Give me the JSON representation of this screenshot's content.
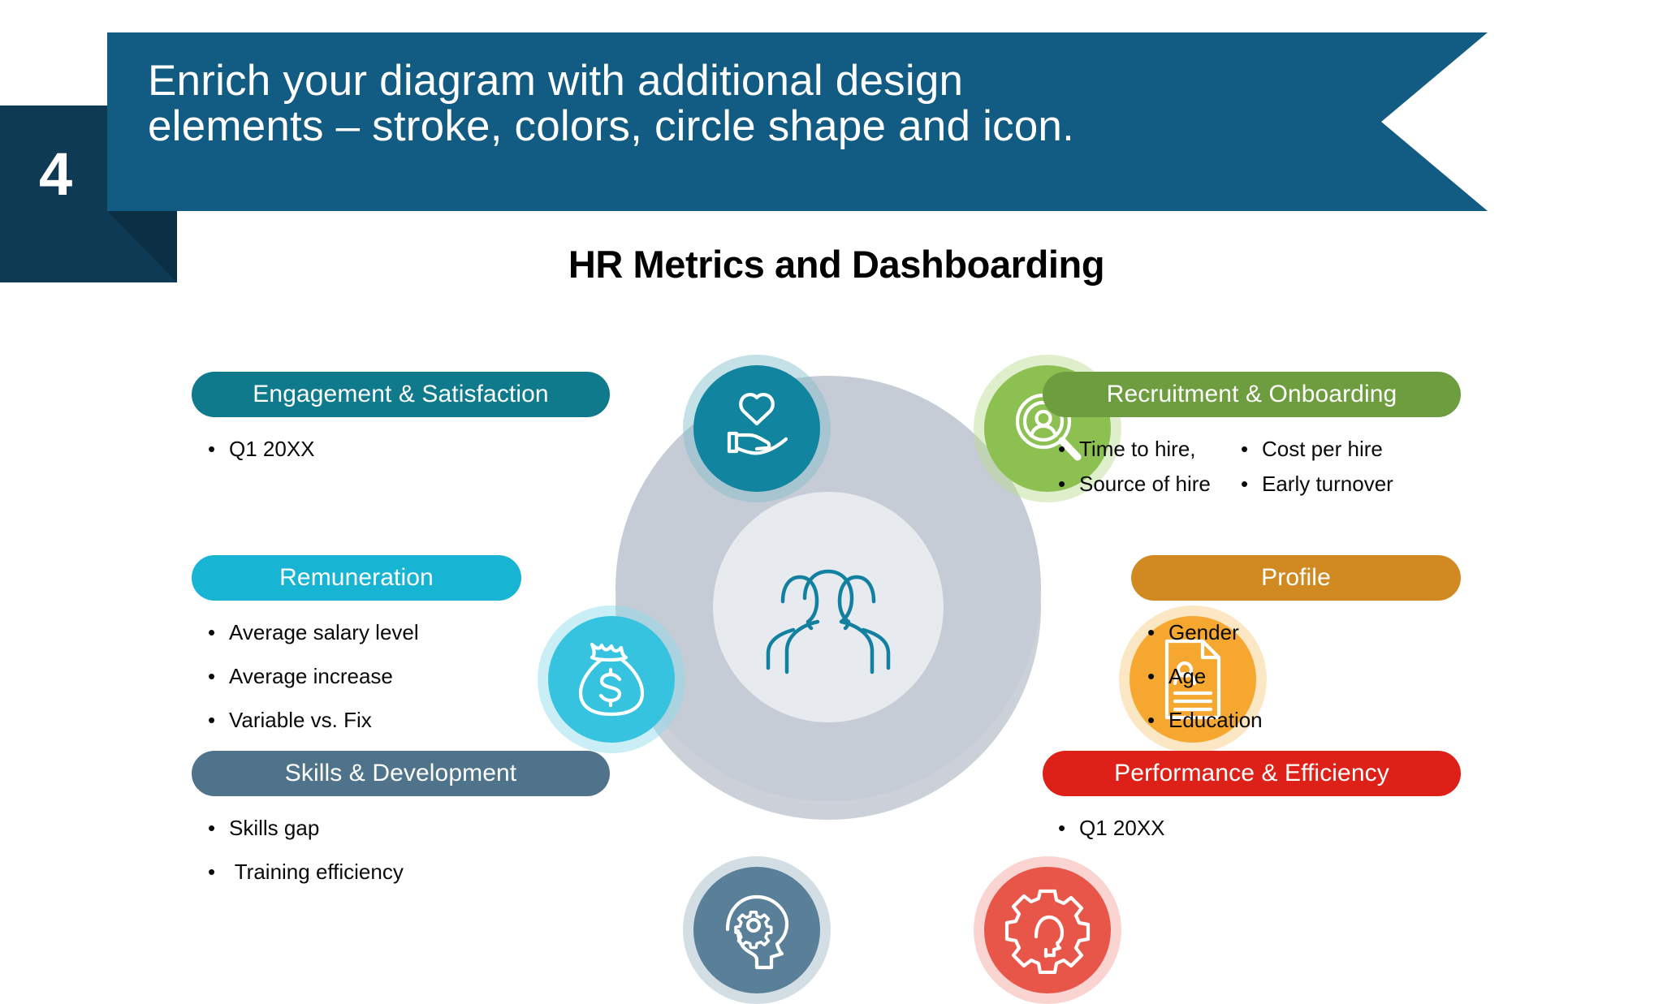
{
  "slide": {
    "number": "4",
    "header_title": "Enrich your diagram with additional design\nelements – stroke, colors, circle shape and icon.",
    "diagram_title": "HR Metrics and Dashboarding",
    "colors": {
      "banner": "#125b82",
      "number_block": "#0e3a54",
      "wheel_ring": "#c6ccd5",
      "wheel_inner": "#e7eaee",
      "center_icon": "#1280a0"
    }
  },
  "diagram": {
    "center_icon": "people-group-icon",
    "nodes": [
      {
        "key": "engagement",
        "icon": "heart-in-hand-icon",
        "color": "#1185a0",
        "halo": "#7fbccb"
      },
      {
        "key": "recruitment",
        "icon": "person-search-icon",
        "color": "#8cc152",
        "halo": "#b9dc8e"
      },
      {
        "key": "profile",
        "icon": "profile-document-icon",
        "color": "#f5a730",
        "halo": "#f8c97f"
      },
      {
        "key": "performance",
        "icon": "gear-head-icon",
        "color": "#e8564a",
        "halo": "#f2a098"
      },
      {
        "key": "skills",
        "icon": "head-gear-icon",
        "color": "#5a8099",
        "halo": "#9cb4c4"
      },
      {
        "key": "remuneration",
        "icon": "money-bag-icon",
        "color": "#35c3e0",
        "halo": "#8ad9ea"
      }
    ]
  },
  "sections": {
    "engagement": {
      "title": "Engagement & Satisfaction",
      "color": "#0e7a8c",
      "bullets": [
        "Q1 20XX"
      ]
    },
    "remuneration": {
      "title": "Remuneration",
      "color": "#17b4d4",
      "bullets": [
        "Average salary level",
        "Average increase",
        "Variable vs. Fix"
      ]
    },
    "skills": {
      "title": "Skills & Development",
      "color": "#4f738a",
      "bullets": [
        "Skills gap",
        " Training efficiency"
      ]
    },
    "recruitment": {
      "title": "Recruitment & Onboarding",
      "color": "#6d9d3e",
      "bullets_col1": [
        "Time to hire,",
        "Source of hire"
      ],
      "bullets_col2": [
        "Cost per hire",
        "Early turnover"
      ]
    },
    "profile": {
      "title": "Profile",
      "color": "#d18a22",
      "bullets": [
        "Gender",
        "Age",
        "Education"
      ]
    },
    "performance": {
      "title": "Performance & Efficiency",
      "color": "#dd2118",
      "bullets": [
        "Q1 20XX"
      ]
    }
  },
  "bullet_glyph": "•"
}
